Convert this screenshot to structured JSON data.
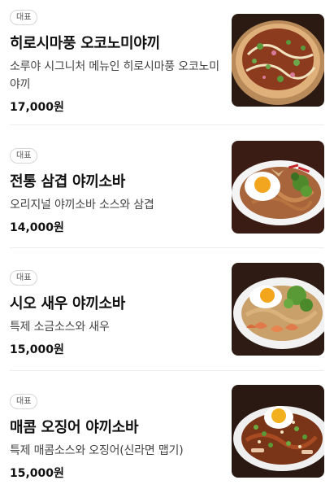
{
  "menu": {
    "items": [
      {
        "badge": "대표",
        "name": "히로시마풍 오코노미야끼",
        "description": "소루야 시그니처 메뉴인 히로시마풍 오코노미야끼",
        "price": "17,000원",
        "image": "okonomiyaki-photo"
      },
      {
        "badge": "대표",
        "name": "전통 삼겹 야끼소바",
        "description": "오리지널 야끼소바 소스와 삼겹",
        "price": "14,000원",
        "image": "pork-yakisoba-photo"
      },
      {
        "badge": "대표",
        "name": "시오 새우 야끼소바",
        "description": "특제 소금소스와 새우",
        "price": "15,000원",
        "image": "shrimp-yakisoba-photo"
      },
      {
        "badge": "대표",
        "name": "매콤 오징어 야끼소바",
        "description": "특제 매콤소스와 오징어(신라면 맵기)",
        "price": "15,000원",
        "image": "squid-yakisoba-photo"
      }
    ]
  }
}
